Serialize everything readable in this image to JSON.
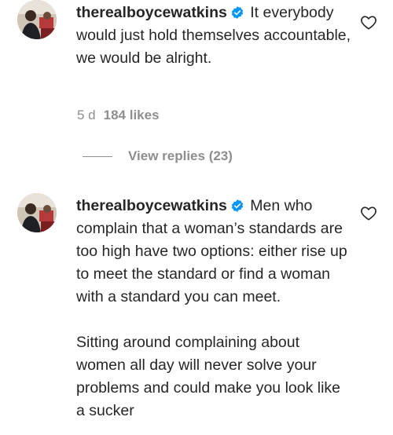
{
  "comments": [
    {
      "username": "therealboycewatkins",
      "text": "It everybody would just hold themselves accountable, we would be alright.",
      "age": "5 d",
      "likes": "184 likes",
      "view_replies": "View replies (23)"
    },
    {
      "username": "therealboycewatkins",
      "text": "Men who complain that a woman’s standards are too high have two options: either rise up to meet the standard or find a woman with a standard you can meet.\n\nSitting around complaining about women all day will never solve your problems and could make you look like a sucker"
    }
  ],
  "colors": {
    "text": "#262626",
    "muted": "#8e8e8e",
    "verified": "#0095f6"
  },
  "icons": {
    "verified": "verified-badge-icon",
    "like": "heart-outline-icon"
  }
}
